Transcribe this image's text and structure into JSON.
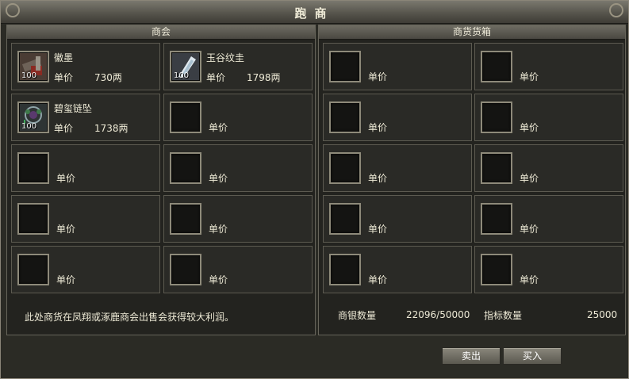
{
  "window": {
    "title": "跑商"
  },
  "left_panel": {
    "title": "商会",
    "items": [
      {
        "name": "徽墨",
        "price_label": "单价",
        "price": "730两",
        "qty": "100",
        "icon": "ink-stick-icon"
      },
      {
        "name": "玉谷纹圭",
        "price_label": "单价",
        "price": "1798两",
        "qty": "100",
        "icon": "jade-tablet-icon"
      },
      {
        "name": "碧玺链坠",
        "price_label": "单价",
        "price": "1738两",
        "qty": "100",
        "icon": "tourmaline-pendant-icon"
      },
      {
        "price_label": "单价"
      },
      {
        "price_label": "单价"
      },
      {
        "price_label": "单价"
      },
      {
        "price_label": "单价"
      },
      {
        "price_label": "单价"
      },
      {
        "price_label": "单价"
      },
      {
        "price_label": "单价"
      }
    ],
    "hint": "此处商货在凤翔或涿鹿商会出售会获得较大利润。"
  },
  "right_panel": {
    "title": "商货货箱",
    "slots": [
      {
        "price_label": "单价"
      },
      {
        "price_label": "单价"
      },
      {
        "price_label": "单价"
      },
      {
        "price_label": "单价"
      },
      {
        "price_label": "单价"
      },
      {
        "price_label": "单价"
      },
      {
        "price_label": "单价"
      },
      {
        "price_label": "单价"
      },
      {
        "price_label": "单价"
      },
      {
        "price_label": "单价"
      }
    ],
    "silver_label": "商银数量",
    "silver_value": "22096/50000",
    "target_label": "指标数量",
    "target_value": "25000"
  },
  "buttons": {
    "sell": "卖出",
    "buy": "买入"
  }
}
